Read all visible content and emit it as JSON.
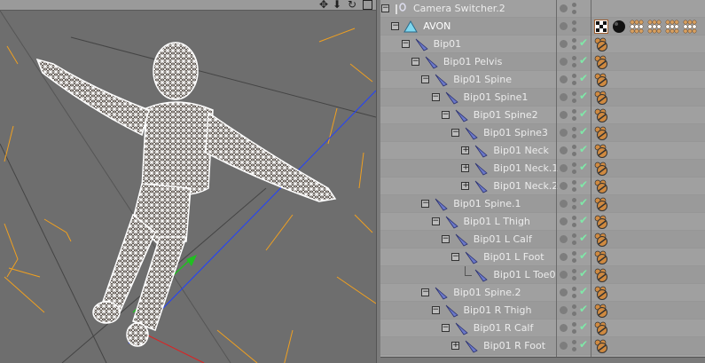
{
  "viewport": {
    "nav_icons": [
      "move-icon",
      "zoom-icon",
      "rotate-icon",
      "maximize-icon"
    ],
    "colors": {
      "background": "#6e6e6e",
      "wireframe": "#ffffff",
      "x_axis": "#e02020",
      "y_axis": "#20c020",
      "z_axis": "#2040ff",
      "camera_lines": "#f0a020"
    }
  },
  "object_manager": {
    "rows": [
      {
        "label": "Camera Switcher.2",
        "depth": 0,
        "expand": "minus",
        "icon": "camera-switcher-icon",
        "tags": []
      },
      {
        "label": "AVON",
        "depth": 1,
        "expand": "minus",
        "icon": "polygon-object-icon",
        "highlight": true,
        "tags": [
          "texture",
          "sphere-material",
          "material",
          "material",
          "material",
          "material"
        ]
      },
      {
        "label": "Bip01",
        "depth": 2,
        "expand": "minus",
        "icon": "bone-icon",
        "check": true,
        "tags": [
          "ik-tag"
        ]
      },
      {
        "label": "Bip01 Pelvis",
        "depth": 3,
        "expand": "minus",
        "icon": "bone-icon",
        "check": true,
        "tags": [
          "ik-tag"
        ]
      },
      {
        "label": "Bip01 Spine",
        "depth": 4,
        "expand": "minus",
        "icon": "bone-icon",
        "check": true,
        "tags": [
          "ik-tag"
        ]
      },
      {
        "label": "Bip01 Spine1",
        "depth": 5,
        "expand": "minus",
        "icon": "bone-icon",
        "check": true,
        "tags": [
          "ik-tag"
        ]
      },
      {
        "label": "Bip01 Spine2",
        "depth": 6,
        "expand": "minus",
        "icon": "bone-icon",
        "check": true,
        "tags": [
          "ik-tag"
        ]
      },
      {
        "label": "Bip01 Spine3",
        "depth": 7,
        "expand": "minus",
        "icon": "bone-icon",
        "check": true,
        "tags": [
          "ik-tag"
        ]
      },
      {
        "label": "Bip01 Neck",
        "depth": 8,
        "expand": "plus",
        "icon": "bone-icon",
        "check": true,
        "tags": [
          "ik-tag"
        ]
      },
      {
        "label": "Bip01 Neck.1",
        "depth": 8,
        "expand": "plus",
        "icon": "bone-icon",
        "check": true,
        "tags": [
          "ik-tag"
        ]
      },
      {
        "label": "Bip01 Neck.2",
        "depth": 8,
        "expand": "plus",
        "icon": "bone-icon",
        "check": true,
        "tags": [
          "ik-tag"
        ]
      },
      {
        "label": "Bip01 Spine.1",
        "depth": 4,
        "expand": "minus",
        "icon": "bone-icon",
        "check": true,
        "tags": [
          "ik-tag"
        ]
      },
      {
        "label": "Bip01 L Thigh",
        "depth": 5,
        "expand": "minus",
        "icon": "bone-icon",
        "check": true,
        "tags": [
          "ik-tag"
        ]
      },
      {
        "label": "Bip01 L Calf",
        "depth": 6,
        "expand": "minus",
        "icon": "bone-icon",
        "check": true,
        "tags": [
          "ik-tag"
        ]
      },
      {
        "label": "Bip01 L Foot",
        "depth": 7,
        "expand": "minus",
        "icon": "bone-icon",
        "check": true,
        "tags": [
          "ik-tag"
        ]
      },
      {
        "label": "Bip01 L Toe0",
        "depth": 8,
        "expand": "none",
        "icon": "bone-icon",
        "check": true,
        "tags": [
          "ik-tag"
        ]
      },
      {
        "label": "Bip01 Spine.2",
        "depth": 4,
        "expand": "minus",
        "icon": "bone-icon",
        "check": true,
        "tags": [
          "ik-tag"
        ]
      },
      {
        "label": "Bip01 R Thigh",
        "depth": 5,
        "expand": "minus",
        "icon": "bone-icon",
        "check": true,
        "tags": [
          "ik-tag"
        ]
      },
      {
        "label": "Bip01 R Calf",
        "depth": 6,
        "expand": "minus",
        "icon": "bone-icon",
        "check": true,
        "tags": [
          "ik-tag"
        ]
      },
      {
        "label": "Bip01 R Foot",
        "depth": 7,
        "expand": "plus",
        "icon": "bone-icon",
        "check": true,
        "tags": [
          "ik-tag"
        ]
      }
    ]
  }
}
